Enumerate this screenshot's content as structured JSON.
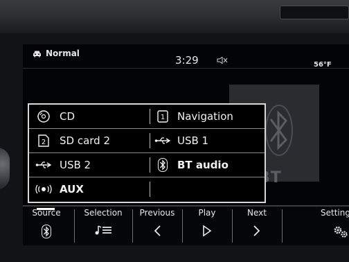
{
  "status_bar": {
    "profile_label": "Normal",
    "time": "3:29",
    "temperature": "56°F"
  },
  "album_art": {
    "text": "BT"
  },
  "source_menu": {
    "items": [
      {
        "label": "CD",
        "icon": "cd-icon"
      },
      {
        "label": "Navigation",
        "icon": "navigation-icon"
      },
      {
        "label": "SD card 2",
        "icon": "sd-card-icon"
      },
      {
        "label": "USB 1",
        "icon": "usb-icon"
      },
      {
        "label": "USB 2",
        "icon": "usb-icon"
      },
      {
        "label": "BT audio",
        "icon": "bluetooth-icon",
        "bold": true
      },
      {
        "label": "AUX",
        "icon": "aux-icon",
        "bold": true
      }
    ]
  },
  "bottom_bar": {
    "tabs": [
      {
        "label": "Source",
        "icon": "bluetooth-icon",
        "active": true
      },
      {
        "label": "Selection",
        "icon": "playlist-icon"
      },
      {
        "label": "Previous",
        "icon": "previous-icon"
      },
      {
        "label": "Play",
        "icon": "play-icon"
      },
      {
        "label": "Next",
        "icon": "next-icon"
      },
      {
        "label": "Settings",
        "icon": "gear-icon"
      }
    ]
  },
  "colors": {
    "screen_bg": "#030405",
    "text": "#f2f2f2",
    "border": "#d8d8d8"
  }
}
